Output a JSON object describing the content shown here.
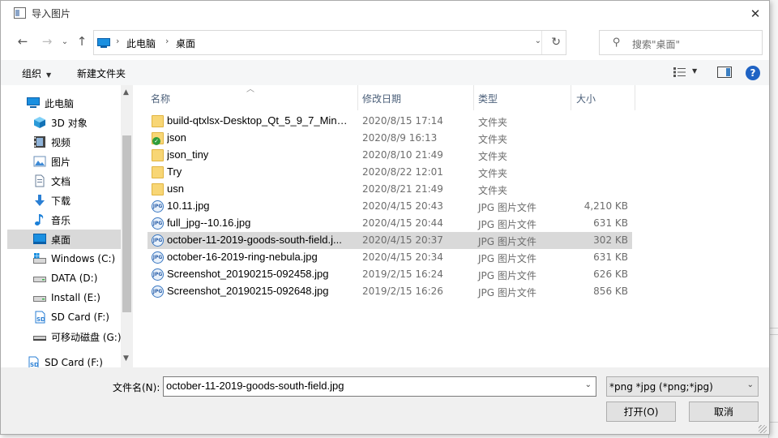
{
  "window": {
    "title": "导入图片"
  },
  "nav": {
    "back": "←",
    "forward": "→",
    "recent": "⌄",
    "up": "↑",
    "breadcrumb": [
      "此电脑",
      "桌面"
    ],
    "search_placeholder": "搜索\"桌面\""
  },
  "toolbar": {
    "organize": "组织",
    "new_folder": "新建文件夹"
  },
  "tree": [
    {
      "label": "此电脑",
      "icon": "computer-icon"
    },
    {
      "label": "3D 对象",
      "icon": "3d-objects-icon"
    },
    {
      "label": "视频",
      "icon": "video-icon"
    },
    {
      "label": "图片",
      "icon": "pictures-icon"
    },
    {
      "label": "文档",
      "icon": "documents-icon"
    },
    {
      "label": "下载",
      "icon": "downloads-icon"
    },
    {
      "label": "音乐",
      "icon": "music-icon"
    },
    {
      "label": "桌面",
      "icon": "desktop-icon",
      "selected": true
    },
    {
      "label": "Windows (C:)",
      "icon": "windows-drive-icon"
    },
    {
      "label": "DATA (D:)",
      "icon": "drive-icon"
    },
    {
      "label": "Install (E:)",
      "icon": "drive-icon"
    },
    {
      "label": "SD Card (F:)",
      "icon": "sd-card-icon"
    },
    {
      "label": "可移动磁盘 (G:)",
      "icon": "removable-drive-icon"
    },
    {
      "label": "SD Card (F:)",
      "icon": "sd-card-icon"
    }
  ],
  "columns": {
    "name": "名称",
    "date": "修改日期",
    "type": "类型",
    "size": "大小"
  },
  "files": [
    {
      "name": "build-qtxlsx-Desktop_Qt_5_9_7_MinG...",
      "date": "2020/8/15 17:14",
      "type": "文件夹",
      "size": "",
      "kind": "folder"
    },
    {
      "name": "json",
      "date": "2020/8/9 16:13",
      "type": "文件夹",
      "size": "",
      "kind": "folder-synced"
    },
    {
      "name": "json_tiny",
      "date": "2020/8/10 21:49",
      "type": "文件夹",
      "size": "",
      "kind": "folder"
    },
    {
      "name": "Try",
      "date": "2020/8/22 12:01",
      "type": "文件夹",
      "size": "",
      "kind": "folder"
    },
    {
      "name": "usn",
      "date": "2020/8/21 21:49",
      "type": "文件夹",
      "size": "",
      "kind": "folder"
    },
    {
      "name": "10.11.jpg",
      "date": "2020/4/15 20:43",
      "type": "JPG 图片文件",
      "size": "4,210 KB",
      "kind": "jpg"
    },
    {
      "name": "full_jpg--10.16.jpg",
      "date": "2020/4/15 20:44",
      "type": "JPG 图片文件",
      "size": "631 KB",
      "kind": "jpg"
    },
    {
      "name": "october-11-2019-goods-south-field.j...",
      "date": "2020/4/15 20:37",
      "type": "JPG 图片文件",
      "size": "302 KB",
      "kind": "jpg",
      "selected": true
    },
    {
      "name": "october-16-2019-ring-nebula.jpg",
      "date": "2020/4/15 20:34",
      "type": "JPG 图片文件",
      "size": "631 KB",
      "kind": "jpg"
    },
    {
      "name": "Screenshot_20190215-092458.jpg",
      "date": "2019/2/15 16:24",
      "type": "JPG 图片文件",
      "size": "626 KB",
      "kind": "jpg"
    },
    {
      "name": "Screenshot_20190215-092648.jpg",
      "date": "2019/2/15 16:26",
      "type": "JPG 图片文件",
      "size": "856 KB",
      "kind": "jpg"
    }
  ],
  "bottom": {
    "filename_label": "文件名(N):",
    "filename_value": "october-11-2019-goods-south-field.jpg",
    "filetype_value": "*png *jpg (*png;*jpg)",
    "open_label": "打开(O)",
    "cancel_label": "取消"
  },
  "colors": {
    "accent": "#1f63c4",
    "selected_row": "#d9d9d9",
    "folder": "#f8d675"
  }
}
